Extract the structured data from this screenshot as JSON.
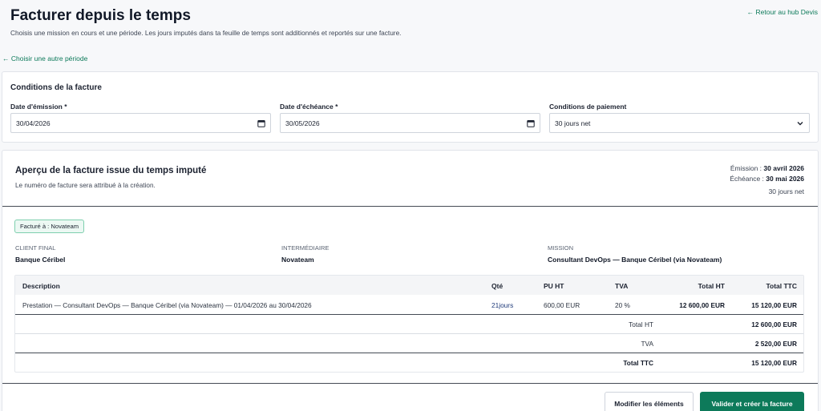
{
  "header": {
    "title": "Facturer depuis le temps",
    "subtitle": "Choisis une mission en cours et une période. Les jours imputés dans ta feuille de temps sont additionnés et reportés sur une facture.",
    "back_hub": "← Retour au hub Devis",
    "back_period": "← Choisir une autre période"
  },
  "conditions": {
    "title": "Conditions de la facture",
    "issue_label": "Date d'émission *",
    "issue_value": "30/04/2026",
    "due_label": "Date d'échéance *",
    "due_value": "30/05/2026",
    "payment_label": "Conditions de paiement",
    "payment_value": "30 jours net"
  },
  "preview": {
    "title": "Aperçu de la facture issue du temps imputé",
    "subtitle": "Le numéro de facture sera attribué à la création.",
    "emission_label": "Émission : ",
    "emission_value": "30 avril 2026",
    "due_label": "Échéance : ",
    "due_value": "30 mai 2026",
    "terms": "30 jours net",
    "badge": "Facturé à : Novateam",
    "client_label": "CLIENT FINAL",
    "client_value": "Banque Céribel",
    "intermediary_label": "INTERMÉDIAIRE",
    "intermediary_value": "Novateam",
    "mission_label": "MISSION",
    "mission_value": "Consultant DevOps — Banque Céribel (via Novateam)"
  },
  "table": {
    "headers": [
      "Description",
      "Qté",
      "PU HT",
      "TVA",
      "Total HT",
      "Total TTC"
    ],
    "row": {
      "description": "Prestation — Consultant DevOps — Banque Céribel (via Novateam) — 01/04/2026 au 30/04/2026",
      "qty": "21jours",
      "unit_price": "600,00 EUR",
      "vat": "20 %",
      "total_ht": "12 600,00 EUR",
      "total_ttc": "15 120,00 EUR"
    },
    "totals": [
      {
        "label": "Total HT",
        "value": "12 600,00 EUR"
      },
      {
        "label": "TVA",
        "value": "2 520,00 EUR"
      },
      {
        "label": "Total TTC",
        "value": "15 120,00 EUR"
      }
    ]
  },
  "actions": {
    "edit": "Modifier les éléments",
    "validate": "Valider et créer la facture"
  },
  "colors": {
    "accent": "#0d7a5a"
  }
}
